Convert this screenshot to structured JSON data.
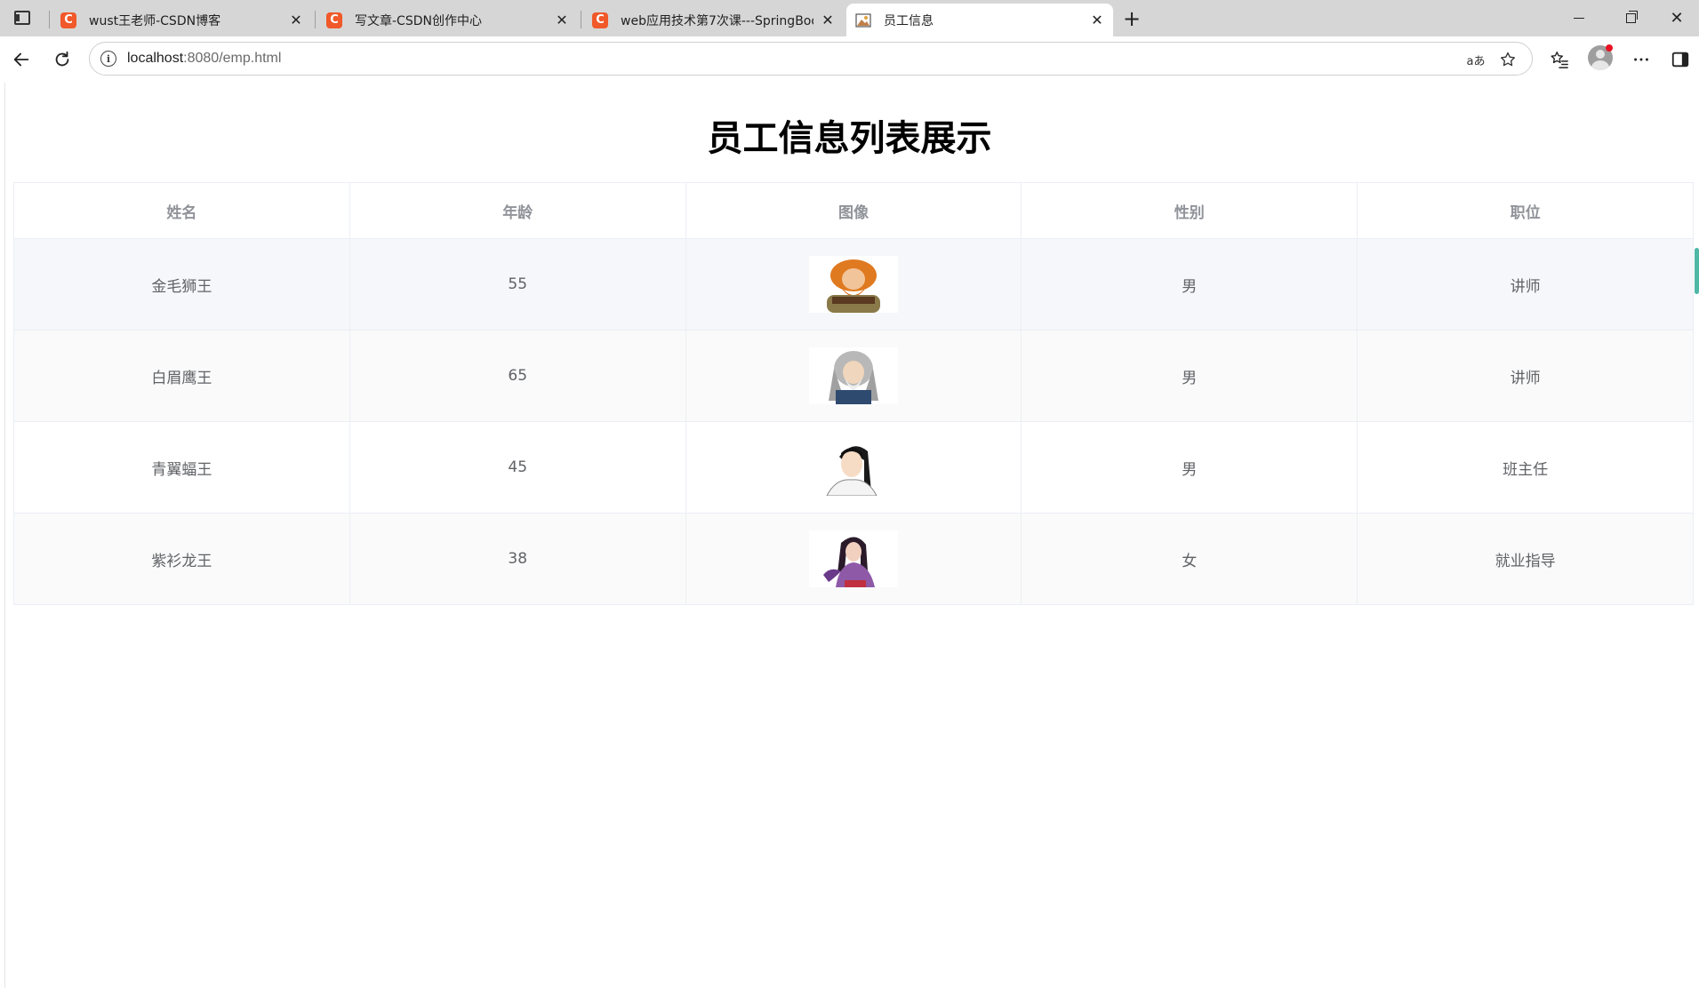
{
  "tabs": [
    {
      "title": "wust王老师-CSDN博客",
      "favicon": "C"
    },
    {
      "title": "写文章-CSDN创作中心",
      "favicon": "C"
    },
    {
      "title": "web应用技术第7次课---SpringBoot",
      "favicon": "C"
    },
    {
      "title": "员工信息",
      "favicon": "image-icon"
    }
  ],
  "address": {
    "host": "localhost",
    "path": ":8080/emp.html",
    "read_aloud": "aあ"
  },
  "colors": {
    "csdn_red": "#f1592a",
    "header_text": "#909399",
    "cell_text": "#606266",
    "border": "#ebeef5",
    "row_hover": "#f5f7fa",
    "row_stripe": "#fafafa"
  },
  "page": {
    "title": "员工信息列表展示"
  },
  "table": {
    "headers": [
      "姓名",
      "年龄",
      "图像",
      "性别",
      "职位"
    ],
    "rows": [
      {
        "name": "金毛狮王",
        "age": "55",
        "gender": "男",
        "job": "讲师"
      },
      {
        "name": "白眉鹰王",
        "age": "65",
        "gender": "男",
        "job": "讲师"
      },
      {
        "name": "青翼蝠王",
        "age": "45",
        "gender": "男",
        "job": "班主任"
      },
      {
        "name": "紫衫龙王",
        "age": "38",
        "gender": "女",
        "job": "就业指导"
      }
    ]
  }
}
